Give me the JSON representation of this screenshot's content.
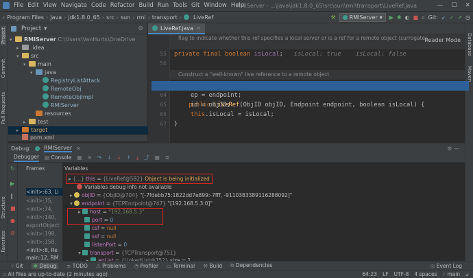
{
  "menu": {
    "items": [
      "File",
      "Edit",
      "View",
      "Navigate",
      "Code",
      "Refactor",
      "Build",
      "Run",
      "Tools",
      "Git",
      "Window",
      "Help"
    ],
    "window_title": "RMIServer - ...\\Java\\jdk1.8.0_65\\src\\sun\\rmi\\transport\\LiveRef.java"
  },
  "breadcrumb": [
    "Program Files",
    "Java",
    "jdk1.8.0_65",
    "src",
    "sun",
    "rmi",
    "transport",
    "LiveRef"
  ],
  "run_config": "RMIServer",
  "git_label": "Git:",
  "project": {
    "title": "Project",
    "root": "RMIServer",
    "root_path": "C:\\Users\\VanHurts\\OneDrive",
    "items": [
      ".idea",
      "src",
      "main",
      "java",
      "RegistryListAttack",
      "RemoteObj",
      "RemoteObjImpl",
      "RMIServer",
      "resources",
      "test",
      "target",
      "pom.xml"
    ]
  },
  "editor": {
    "tab": "LiveRef.java",
    "reader_mode": "Reader Mode",
    "doc1": "flag to indicate whether this ref specifies a local server or is a ref for a remote object (surrogate)",
    "doc2": "Construct a \"well-known\" live reference to a remote object",
    "line_numbers": [
      "55",
      "56",
      "",
      "63",
      "64",
      "65",
      "66",
      "67"
    ],
    "code": {
      "l55_kw": "private final boolean",
      "l55_field": "isLocal",
      "l55_hint": "isLocal: true    isLocal: false",
      "l63_kw": "public",
      "l63_fn": "LiveRef",
      "l63_rest": "(ObjID objID, Endpoint endpoint, boolean isLocal) {",
      "l63_hint": "objID",
      "l64": "ep = endpoint;",
      "l65": "id = objID;",
      "l66_this": "this",
      "l66_rest": ".isLocal = isLocal;",
      "l67": "}"
    }
  },
  "debug": {
    "label": "Debug:",
    "session": "RMIServer",
    "tab_debugger": "Debugger",
    "tab_console": "Console",
    "frames_label": "Frames",
    "variables_label": "Variables",
    "frames": [
      "<init>:63, Li",
      "<init>:75, ",
      "<init>:74, ",
      "<init>:140, ",
      "exportObject",
      "<init>:198, ",
      "<init>:158, ",
      "<init>:8, Re",
      "main:12, RM"
    ],
    "vars": [
      {
        "name": "this",
        "eq": " = ",
        "val": "{LiveRef@582}",
        "extra": "Object is being initialized"
      },
      {
        "name": "",
        "eq": "",
        "val": "Variables debug info not available",
        "extra": ""
      },
      {
        "name": "objID",
        "eq": " = ",
        "val": "{ObjID@704}",
        "extra": "\"[-7fdebb75:1822dd7e899:-7fff, -9110383389116288092]\""
      },
      {
        "name": "endpoint",
        "eq": " = ",
        "val": "{TCPEndpoint@747}",
        "extra": "\"[192.168.5.3:0]\""
      },
      {
        "name": "host",
        "eq": " = ",
        "val": "\"192.168.5.3\"",
        "extra": ""
      },
      {
        "name": "port",
        "eq": " = ",
        "val": "0",
        "extra": ""
      },
      {
        "name": "csf",
        "eq": " = ",
        "val": "null",
        "extra": ""
      },
      {
        "name": "ssf",
        "eq": " = ",
        "val": "null",
        "extra": ""
      },
      {
        "name": "listenPort",
        "eq": " = ",
        "val": "0",
        "extra": ""
      },
      {
        "name": "transport",
        "eq": " = ",
        "val": "{TCPTransport@751}",
        "extra": ""
      },
      {
        "name": "epList",
        "eq": " = ",
        "val": "{LinkedList@752}",
        "extra": "size = 1"
      }
    ]
  },
  "toolwindows": [
    "Git",
    "Debug",
    "TODO",
    "Problems",
    "Profiler",
    "Terminal",
    "Build",
    "Dependencies"
  ],
  "event_log": "Event Log",
  "left_tabs": [
    "Project",
    "Commit",
    "Pull Requests",
    "Structure",
    "Favorites"
  ],
  "right_tabs": [
    "Database",
    "Maven"
  ],
  "status": {
    "message": "All files are up-to-date (2 minutes ago)",
    "position": "64:23",
    "line_sep": "LF",
    "encoding": "UTF-8",
    "indent": "4 spaces",
    "branch": "main"
  }
}
